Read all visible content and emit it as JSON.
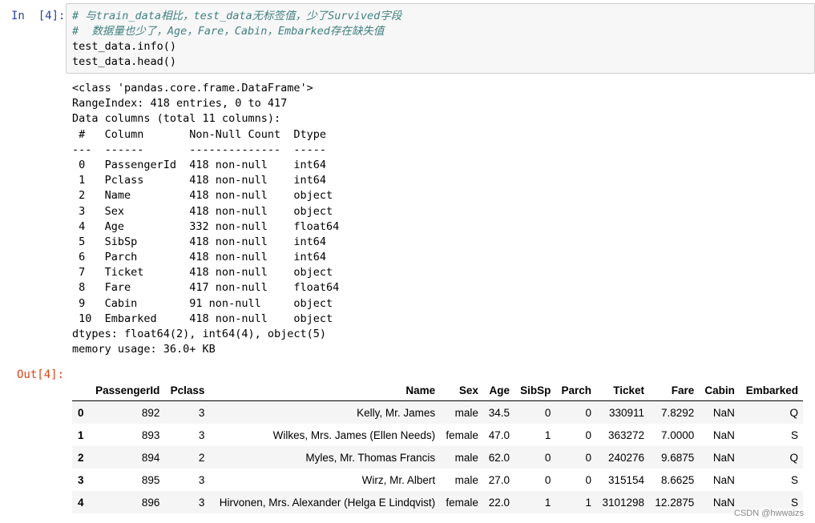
{
  "input_prompt": "In  [4]:",
  "output_prompt": "Out[4]:",
  "code_lines": [
    {
      "text": "# 与train_data相比，test_data无标签值，少了Survived字段",
      "kind": "comment"
    },
    {
      "text": "#  数据量也少了，Age，Fare，Cabin，Embarked存在缺失值",
      "kind": "comment"
    },
    {
      "text": "test_data.info()",
      "kind": "code"
    },
    {
      "text": "test_data.head()",
      "kind": "code"
    }
  ],
  "info_lines": [
    "<class 'pandas.core.frame.DataFrame'>",
    "RangeIndex: 418 entries, 0 to 417",
    "Data columns (total 11 columns):",
    " #   Column       Non-Null Count  Dtype  ",
    "---  ------       --------------  -----  ",
    " 0   PassengerId  418 non-null    int64  ",
    " 1   Pclass       418 non-null    int64  ",
    " 2   Name         418 non-null    object ",
    " 3   Sex          418 non-null    object ",
    " 4   Age          332 non-null    float64",
    " 5   SibSp        418 non-null    int64  ",
    " 6   Parch        418 non-null    int64  ",
    " 7   Ticket       418 non-null    object ",
    " 8   Fare         417 non-null    float64",
    " 9   Cabin        91 non-null     object ",
    " 10  Embarked     418 non-null    object ",
    "dtypes: float64(2), int64(4), object(5)",
    "memory usage: 36.0+ KB"
  ],
  "table": {
    "columns": [
      "",
      "PassengerId",
      "Pclass",
      "Name",
      "Sex",
      "Age",
      "SibSp",
      "Parch",
      "Ticket",
      "Fare",
      "Cabin",
      "Embarked"
    ],
    "rows": [
      [
        "0",
        "892",
        "3",
        "Kelly, Mr. James",
        "male",
        "34.5",
        "0",
        "0",
        "330911",
        "7.8292",
        "NaN",
        "Q"
      ],
      [
        "1",
        "893",
        "3",
        "Wilkes, Mrs. James (Ellen Needs)",
        "female",
        "47.0",
        "1",
        "0",
        "363272",
        "7.0000",
        "NaN",
        "S"
      ],
      [
        "2",
        "894",
        "2",
        "Myles, Mr. Thomas Francis",
        "male",
        "62.0",
        "0",
        "0",
        "240276",
        "9.6875",
        "NaN",
        "Q"
      ],
      [
        "3",
        "895",
        "3",
        "Wirz, Mr. Albert",
        "male",
        "27.0",
        "0",
        "0",
        "315154",
        "8.6625",
        "NaN",
        "S"
      ],
      [
        "4",
        "896",
        "3",
        "Hirvonen, Mrs. Alexander (Helga E Lindqvist)",
        "female",
        "22.0",
        "1",
        "1",
        "3101298",
        "12.2875",
        "NaN",
        "S"
      ]
    ]
  },
  "watermark": "CSDN @hwwaizs",
  "colors": {
    "input_prompt": "#303f9f",
    "output_prompt": "#d84315",
    "comment": "#408080",
    "cell_background": "#f7f7f7"
  }
}
